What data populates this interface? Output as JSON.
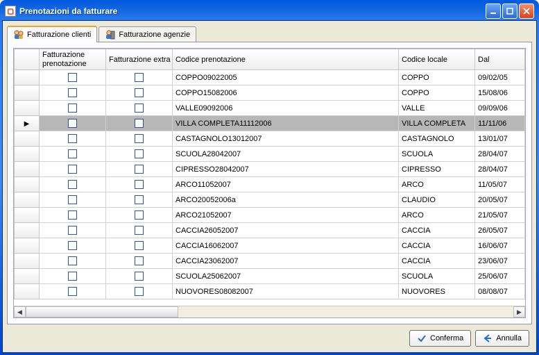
{
  "window": {
    "title": "Prenotazioni da fatturare"
  },
  "tabs": {
    "clienti": "Fatturazione clienti",
    "agenzie": "Fatturazione agenzie"
  },
  "columns": {
    "fatt_pren": "Fatturazione prenotazione",
    "fatt_extra": "Fatturazione extra",
    "codice_pren": "Codice prenotazione",
    "codice_loc": "Codice locale",
    "dal": "Dal"
  },
  "selected_index": 3,
  "rows": [
    {
      "codice_pren": "COPPO09022005",
      "codice_loc": "COPPO",
      "dal": "09/02/05"
    },
    {
      "codice_pren": "COPPO15082006",
      "codice_loc": "COPPO",
      "dal": "15/08/06"
    },
    {
      "codice_pren": "VALLE09092006",
      "codice_loc": "VALLE",
      "dal": "09/09/06"
    },
    {
      "codice_pren": "VILLA COMPLETA11112006",
      "codice_loc": "VILLA COMPLETA",
      "dal": "11/11/06"
    },
    {
      "codice_pren": "CASTAGNOLO13012007",
      "codice_loc": "CASTAGNOLO",
      "dal": "13/01/07"
    },
    {
      "codice_pren": "SCUOLA28042007",
      "codice_loc": "SCUOLA",
      "dal": "28/04/07"
    },
    {
      "codice_pren": "CIPRESSO28042007",
      "codice_loc": "CIPRESSO",
      "dal": "28/04/07"
    },
    {
      "codice_pren": "ARCO11052007",
      "codice_loc": "ARCO",
      "dal": "11/05/07"
    },
    {
      "codice_pren": "ARCO20052006a",
      "codice_loc": "CLAUDIO",
      "dal": "20/05/07"
    },
    {
      "codice_pren": "ARCO21052007",
      "codice_loc": "ARCO",
      "dal": "21/05/07"
    },
    {
      "codice_pren": "CACCIA26052007",
      "codice_loc": "CACCIA",
      "dal": "26/05/07"
    },
    {
      "codice_pren": "CACCIA16062007",
      "codice_loc": "CACCIA",
      "dal": "16/06/07"
    },
    {
      "codice_pren": "CACCIA23062007",
      "codice_loc": "CACCIA",
      "dal": "23/06/07"
    },
    {
      "codice_pren": "SCUOLA25062007",
      "codice_loc": "SCUOLA",
      "dal": "25/06/07"
    },
    {
      "codice_pren": "NUOVORES08082007",
      "codice_loc": "NUOVORES",
      "dal": "08/08/07"
    }
  ],
  "buttons": {
    "confirm": "Conferma",
    "cancel": "Annulla"
  }
}
